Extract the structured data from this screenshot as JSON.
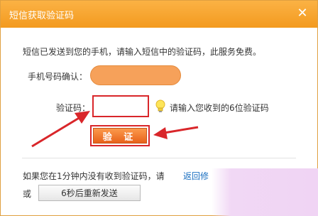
{
  "dialog": {
    "title": "短信获取验证码",
    "close_glyph": "✕"
  },
  "info_text": "短信已发送到您的手机，请输入短信中的验证码，此服务免费。",
  "phone": {
    "label": "手机号码确认："
  },
  "code": {
    "label": "验证码：",
    "value": "",
    "hint": "请输入您收到的6位验证码"
  },
  "verify_button": "验 证",
  "footer": {
    "prompt": "如果您在1分钟内没有收到验证码，请",
    "back_link": "返回修",
    "or": "或",
    "resend_button": "6秒后重新发送"
  },
  "icons": {
    "close": "close-icon",
    "bulb": "lightbulb-icon"
  },
  "colors": {
    "title_bar": "#f39a1f",
    "highlight_red": "#d9262a",
    "verify_button": "#e8621a",
    "link": "#1a6fc0",
    "phone_mask": "#f6a15a"
  }
}
